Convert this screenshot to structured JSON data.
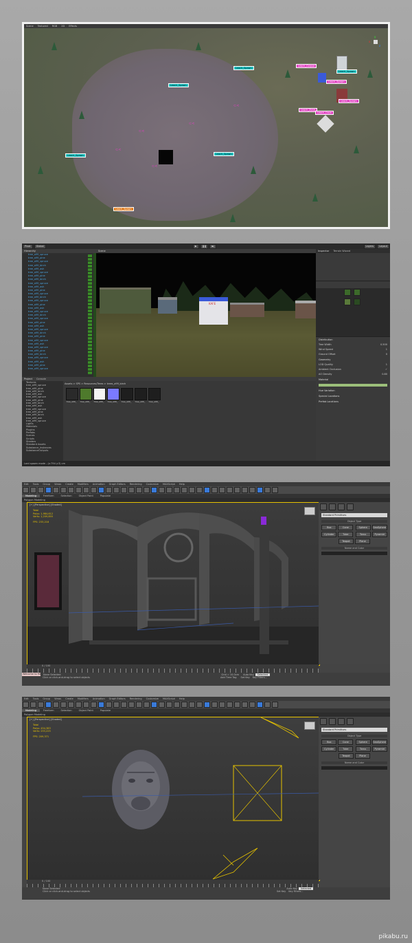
{
  "panel1": {
    "tab": "Scene",
    "toolbar_items": [
      "Textured",
      "RGB",
      "2D",
      "Effects"
    ],
    "axes": [
      "x",
      "y",
      "z"
    ],
    "labels_cyan": [
      "Leach_Spawn",
      "Leach_Spawn",
      "Leach_Spawn",
      "Leach_Spawn",
      "Leach_Spawn"
    ],
    "labels_pink": [
      "Leach_Corpse",
      "Leach_Zone",
      "Leach_Cave",
      "Leach_Spawn",
      "Leach_Spawn"
    ],
    "labels_orange": [
      "Leach_Spawn"
    ],
    "marker_glyph": "⊂<"
  },
  "panel2": {
    "toolbar_left": [
      "Pivot",
      "Global"
    ],
    "play_icons": [
      "play-icon",
      "pause-icon",
      "step-icon"
    ],
    "layers_label": "Layers",
    "layout_label": "Layout",
    "hierarchy_tab": "Hierarchy",
    "scene_tab": "Scene",
    "project_tab": "Project",
    "console_tab": "Console",
    "inspector_tab": "Inspector",
    "terrain_tab": "Terrain Wizard",
    "game_sign": "KAFE",
    "hierarchy_items": [
      "tree_a99_spruce",
      "tree_a99_pine",
      "tree_a99_spruce",
      "tree_a99_birch",
      "tree_a99_ash",
      "tree_a99_spruce",
      "tree_a99_pine",
      "tree_a99_birch",
      "tree_a99_spruce",
      "tree_a99_ash",
      "tree_a99_pine",
      "tree_a99_spruce",
      "tree_a99_birch",
      "tree_a99_spruce",
      "tree_a99_pine",
      "tree_a99_ash",
      "tree_a99_spruce",
      "tree_a99_birch",
      "tree_a99_spruce",
      "tree_a99_pine",
      "tree_a99_ash",
      "tree_a99_spruce",
      "tree_a99_birch",
      "tree_a99_pine",
      "tree_a99_spruce",
      "tree_a99_ash",
      "tree_a99_spruce",
      "tree_a99_pine",
      "tree_a99_birch",
      "tree_a99_spruce",
      "tree_a99_ash",
      "tree_a99_pine",
      "tree_a99_spruce"
    ],
    "project_tree": [
      "Textures",
      "tree_a99_spruce",
      "tree_a99_pine",
      "tree_a99_birch",
      "tree_a99_ash",
      "tree_a99_spruce",
      "tree_a99_pine",
      "tree_a99_birch",
      "tree_a99_ash",
      "tree_a99_spruce",
      "tree_a99_pine",
      "tree_a99_birch",
      "tree_a99_ash",
      "tree_a99_spruce",
      "Lights",
      "Materials",
      "Plugins",
      "Prefabs",
      "Scenes",
      "Scripts",
      "Shaders",
      "Standard Assets",
      "Substance_Instances",
      "SubstanceOutputs"
    ],
    "breadcrumb": "Assets > SPS > Resources/Trees > trees_a99_birch",
    "assets": [
      {
        "label": "tree_a99_",
        "color": "#2a2a2a"
      },
      {
        "label": "tree_a99_",
        "color": "#4e7a2c"
      },
      {
        "label": "tree_a99_",
        "color": "#f4f4f4"
      },
      {
        "label": "tree_a99_",
        "color": "#7a7aff"
      },
      {
        "label": "tree_a99_",
        "color": "#1e1e1e"
      },
      {
        "label": "tree_a99_",
        "color": "#1e1e1e"
      },
      {
        "label": "tree_a99_",
        "color": "#1e1e1e"
      }
    ],
    "inspector_rows": [
      {
        "k": "Tree Width",
        "v": "0.500"
      },
      {
        "k": "Wind Speed",
        "v": "1"
      },
      {
        "k": "Ground Offset",
        "v": "0"
      },
      {
        "k": "LOD Quality",
        "v": "1"
      },
      {
        "k": "Ambient Occlusion",
        "v": "✓"
      },
      {
        "k": "AO Density",
        "v": "0.80"
      }
    ],
    "inspector_sections": [
      "Distribution",
      "Geometry",
      "Material",
      "Hue Variation",
      "Special Locations",
      "Prefab Locations"
    ],
    "status": "Lord spawn mode - (x:794 y:3) cm"
  },
  "panel3": {
    "menu": [
      "Edit",
      "Tools",
      "Group",
      "Views",
      "Create",
      "Modifiers",
      "Animation",
      "Graph Editors",
      "Rendering",
      "Customize",
      "MAXScript",
      "Help"
    ],
    "ribbon_tabs": [
      "Modeling",
      "Freeform",
      "Selection",
      "Object Paint",
      "Populate"
    ],
    "ribbon_sub": "Polygon Modeling",
    "viewport_label": "[+] [Perspective] [Shaded]",
    "stats": {
      "title": "Total",
      "polys": "Polys: 1,984,612",
      "verts": "Verts: 1,209,855",
      "fps_label": "FPS:",
      "fps": "233,218"
    },
    "dropdown": "Standard Primitives",
    "object_type": "Object Type",
    "autogrid": "AutoGrid",
    "buttons": [
      "Box",
      "Cone",
      "Sphere",
      "GeoSphere",
      "Cylinder",
      "Tube",
      "Torus",
      "Pyramid",
      "Teapot",
      "Plane"
    ],
    "name_color": "Name and Color",
    "timeline": "0 / 100",
    "status_left": "None Selected",
    "status_prompt": "Click or click-and-drag to select objects",
    "welcome": "Welcome to MA",
    "autokey": "Auto Key",
    "selected": "Selected",
    "setkey": "Set Key",
    "keyfilters": "Key Filters...",
    "grid": "Grid = 10.0cm",
    "addtime": "Add Time Tag"
  },
  "panel4": {
    "ribbon_tabs": [
      "Modeling",
      "Freeform",
      "Selection",
      "Object Paint",
      "Populate"
    ],
    "ribbon_sub": "Polygon Modeling",
    "viewport_label": "[+] [Perspective] [Shaded]",
    "stats": {
      "title": "Total",
      "polys": "Polys: 454,383",
      "verts": "Verts: 233,225",
      "fps_label": "FPS:",
      "fps": "209,371"
    },
    "dropdown": "Standard Primitives",
    "object_type": "Object Type",
    "buttons": [
      "Box",
      "Cone",
      "Sphere",
      "GeoSphere",
      "Cylinder",
      "Tube",
      "Torus",
      "Pyramid",
      "Teapot",
      "Plane"
    ],
    "name_color": "Name and Color",
    "timeline": "0 / 100",
    "status_left": "None Selected",
    "status_prompt": "Click or click-and-drag to select objects",
    "autokey": "Auto Key",
    "selected": "Selected",
    "setkey": "Set Key",
    "keyfilters": "Key Filters..."
  },
  "watermark": "pikabu.ru",
  "colors": {
    "cyan": "#20c4c0",
    "pink": "#e03fc0",
    "orange": "#e07a1a",
    "selection": "#e6c200",
    "blue_text": "#4aa3df"
  }
}
